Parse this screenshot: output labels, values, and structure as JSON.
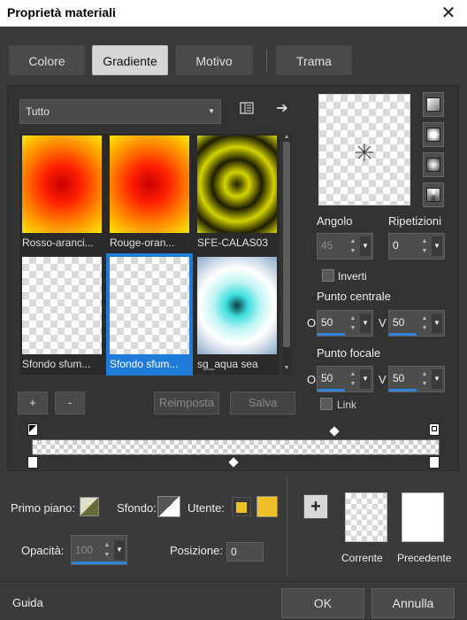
{
  "window": {
    "title": "Proprietà materiali",
    "close_glyph": "✕"
  },
  "tabs": [
    {
      "label": "Colore",
      "active": false
    },
    {
      "label": "Gradiente",
      "active": true
    },
    {
      "label": "Motivo",
      "active": false
    },
    {
      "label": "Trama",
      "active": false
    }
  ],
  "gradient_panel": {
    "category": "Tutto",
    "thumbnails": [
      {
        "label": "Rosso-aranci..."
      },
      {
        "label": "Rouge-oran..."
      },
      {
        "label": "SFE-CALAS03"
      },
      {
        "label": "Sfondo sfum..."
      },
      {
        "label": "Sfondo sfum...",
        "selected": true
      },
      {
        "label": "sg_aqua sea"
      }
    ],
    "add_label": "+",
    "remove_label": "-",
    "reset_label": "Reimposta",
    "save_label": "Salva"
  },
  "settings": {
    "angle_label": "Angolo",
    "angle_value": "45",
    "repetitions_label": "Ripetizioni",
    "repetitions_value": "0",
    "invert_label": "Inverti",
    "center_label": "Punto centrale",
    "center_h_prefix": "O",
    "center_h": "50",
    "center_v_prefix": "V",
    "center_v": "50",
    "focal_label": "Punto focale",
    "focal_h_prefix": "O",
    "focal_h": "50",
    "focal_v_prefix": "V",
    "focal_v": "50",
    "link_label": "Link",
    "center_h_fill": 0.5,
    "center_v_fill": 0.5,
    "focal_h_fill": 0.5,
    "focal_v_fill": 0.5
  },
  "materials": {
    "foreground_label": "Primo piano:",
    "background_label": "Sfondo:",
    "user_label": "Utente:",
    "opacity_label": "Opacità:",
    "opacity_value": "100",
    "position_label": "Posizione:",
    "position_value": "0",
    "current_label": "Corrente",
    "previous_label": "Precedente",
    "user_color_1": "#f0c028",
    "user_color_2": "#f0c028",
    "accent": "#1e7cd8"
  },
  "footer": {
    "help_label": "Guida",
    "ok_label": "OK",
    "cancel_label": "Annulla"
  }
}
